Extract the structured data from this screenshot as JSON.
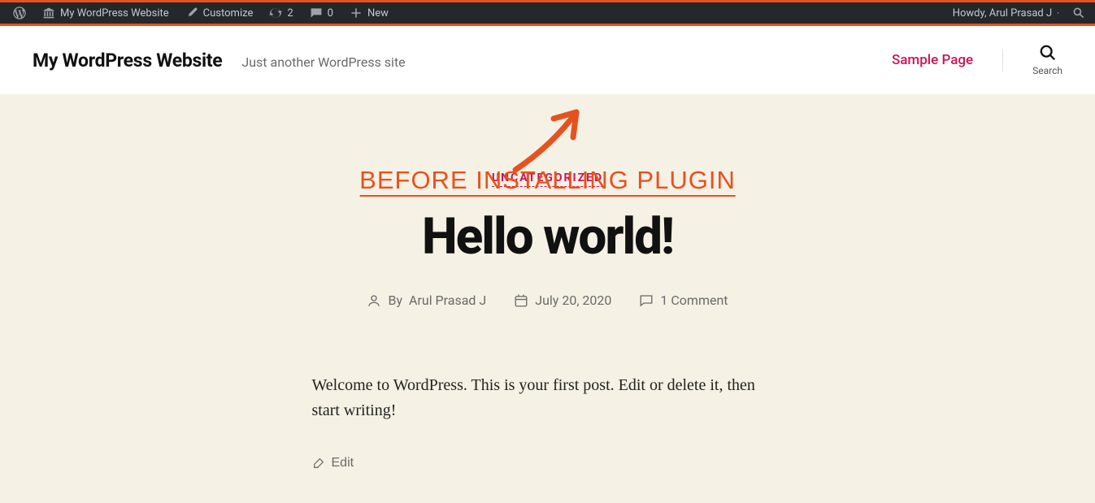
{
  "adminbar": {
    "site_name": "My WordPress Website",
    "customize": "Customize",
    "updates_count": "2",
    "comments_count": "0",
    "new_label": "New",
    "howdy": "Howdy, Arul Prasad J"
  },
  "header": {
    "title": "My WordPress Website",
    "tagline": "Just another WordPress site",
    "nav_sample_page": "Sample Page",
    "search_label": "Search"
  },
  "annotation": {
    "text": "BEFORE INSTALLING PLUGIN"
  },
  "post": {
    "category": "UNCATEGORIZED",
    "title": "Hello world!",
    "by_label": "By",
    "author": "Arul Prasad J",
    "date": "July 20, 2020",
    "comments": "1 Comment",
    "body": "Welcome to WordPress. This is your first post. Edit or delete it, then start writing!",
    "edit_label": "Edit"
  },
  "colors": {
    "accent_orange": "#e6521f",
    "accent_pink": "#c9145a",
    "cream_bg": "#f5f1e4"
  }
}
